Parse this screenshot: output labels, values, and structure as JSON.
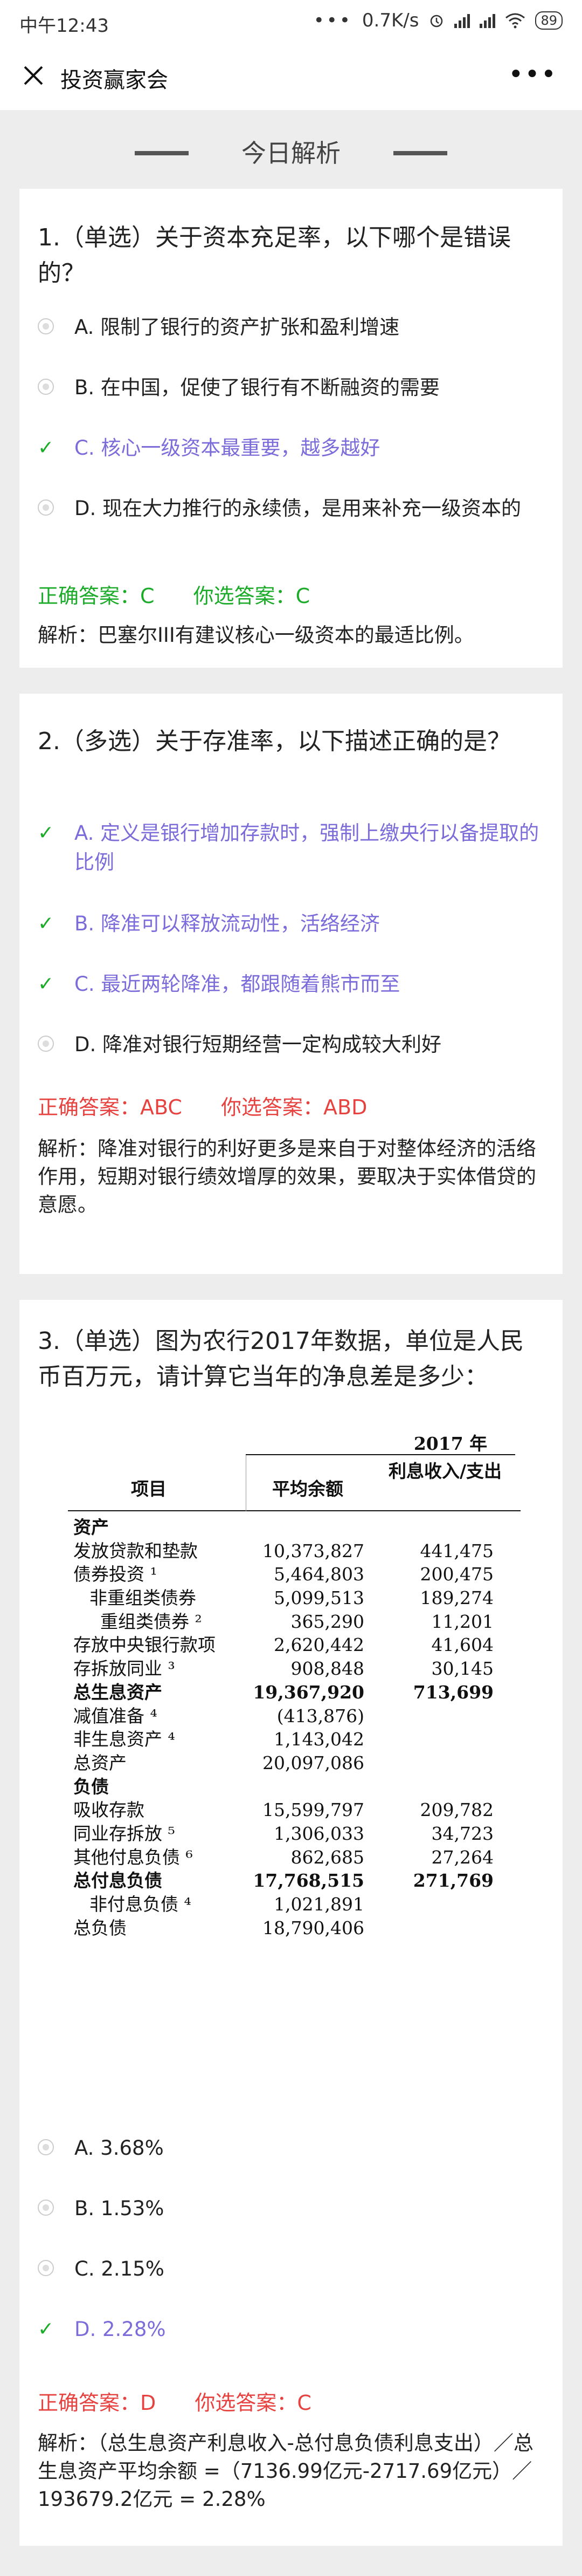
{
  "statusbar": {
    "time": "中午12:43",
    "dots": "•••",
    "speed": "0.7K/s",
    "battery": "89",
    "alarm_icon": "alarm-icon",
    "wifi_icon": "wifi-icon"
  },
  "navbar": {
    "close_icon": "close-icon",
    "title": "投资赢家会",
    "more": "•••"
  },
  "heading": "今日解析",
  "q1": {
    "title": "1.（单选）关于资本充足率，以下哪个是错误的？",
    "options": [
      "A. 限制了银行的资产扩张和盈利增速",
      "B. 在中国，促使了银行有不断融资的需要",
      "C. 核心一级资本最重要，越多越好",
      "D. 现在大力推行的永续债，是用来补充一级资本的"
    ],
    "correct": "正确答案：C",
    "chosen": "你选答案：C",
    "explain": "解析：巴塞尔III有建议核心一级资本的最适比例。"
  },
  "q2": {
    "title": "2.（多选）关于存准率，以下描述正确的是？",
    "options": [
      "A. 定义是银行增加存款时，强制上缴央行以备提取的比例",
      "B. 降准可以释放流动性，活络经济",
      "C. 最近两轮降准，都跟随着熊市而至",
      "D. 降准对银行短期经营一定构成较大利好"
    ],
    "correct": "正确答案：ABC",
    "chosen": "你选答案：ABD",
    "explain": "解析：降准对银行的利好更多是来自于对整体经济的活络作用，短期对银行绩效增厚的效果，要取决于实体借贷的意愿。"
  },
  "q3": {
    "title": "3.（单选）图为农行2017年数据，单位是人民币百万元，请计算它当年的净息差是多少：",
    "table": {
      "year": "2017 年",
      "col_item": "项目",
      "col_avg": "平均余额",
      "col_interest": "利息收入/支出",
      "rows": [
        {
          "label": "资产",
          "avg": "",
          "int": "",
          "bold": true,
          "ind": 0
        },
        {
          "label": "发放贷款和垫款",
          "avg": "10,373,827",
          "int": "441,475",
          "bold": false,
          "ind": 0
        },
        {
          "label": "债券投资 ¹",
          "avg": "5,464,803",
          "int": "200,475",
          "bold": false,
          "ind": 0
        },
        {
          "label": "非重组类债券",
          "avg": "5,099,513",
          "int": "189,274",
          "bold": false,
          "ind": 1
        },
        {
          "label": "重组类债券 ²",
          "avg": "365,290",
          "int": "11,201",
          "bold": false,
          "ind": 2
        },
        {
          "label": "存放中央银行款项",
          "avg": "2,620,442",
          "int": "41,604",
          "bold": false,
          "ind": 0
        },
        {
          "label": "存拆放同业 ³",
          "avg": "908,848",
          "int": "30,145",
          "bold": false,
          "ind": 0
        },
        {
          "label": "总生息资产",
          "avg": "19,367,920",
          "int": "713,699",
          "bold": true,
          "ind": 0
        },
        {
          "label": "减值准备 ⁴",
          "avg": "(413,876)",
          "int": "",
          "bold": false,
          "ind": 0
        },
        {
          "label": "非生息资产 ⁴",
          "avg": "1,143,042",
          "int": "",
          "bold": false,
          "ind": 0
        },
        {
          "label": "总资产",
          "avg": "20,097,086",
          "int": "",
          "bold": false,
          "ind": 0
        },
        {
          "label": "负债",
          "avg": "",
          "int": "",
          "bold": true,
          "ind": 0
        },
        {
          "label": "吸收存款",
          "avg": "15,599,797",
          "int": "209,782",
          "bold": false,
          "ind": 0
        },
        {
          "label": "同业存拆放 ⁵",
          "avg": "1,306,033",
          "int": "34,723",
          "bold": false,
          "ind": 0
        },
        {
          "label": "其他付息负债 ⁶",
          "avg": "862,685",
          "int": "27,264",
          "bold": false,
          "ind": 0
        },
        {
          "label": "总付息负债",
          "avg": "17,768,515",
          "int": "271,769",
          "bold": true,
          "ind": 0
        },
        {
          "label": "非付息负债 ⁴",
          "avg": "1,021,891",
          "int": "",
          "bold": false,
          "ind": 1
        },
        {
          "label": "总负债",
          "avg": "18,790,406",
          "int": "",
          "bold": false,
          "ind": 0
        }
      ]
    },
    "options": [
      "A. 3.68%",
      "B. 1.53%",
      "C. 2.15%",
      "D. 2.28%"
    ],
    "correct": "正确答案：D",
    "chosen": "你选答案：C",
    "explain": "解析：（总生息资产利息收入-总付息负债利息支出）／总生息资产平均余额 =（7136.99亿元-2717.69亿元）／193679.2亿元 = 2.28%"
  }
}
